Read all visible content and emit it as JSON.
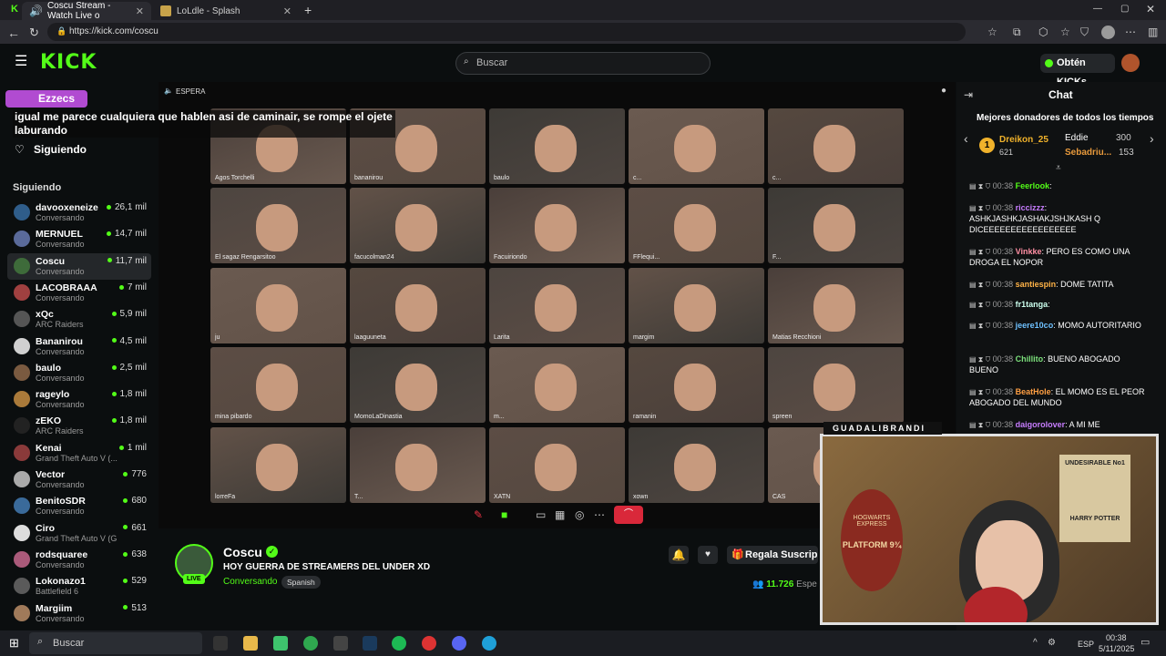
{
  "browser": {
    "tabs": [
      {
        "title": "Coscu Stream - Watch Live o",
        "active": true
      },
      {
        "title": "LoLdle - Splash",
        "active": false
      }
    ],
    "url": "https://kick.com/coscu"
  },
  "header": {
    "search_placeholder": "Buscar",
    "kicks_button": "Obtén KICKs",
    "logo": "KICK"
  },
  "overlay": {
    "user": "Ezzecs",
    "message": "igual me parece cualquiera que hablen asi de caminair, se rompe el ojete laburando"
  },
  "sidebar": {
    "following_label": "Siguiendo",
    "section_label": "Siguiendo",
    "items": [
      {
        "name": "davooxeneize",
        "sub": "Conversando",
        "viewers": "26,1 mil"
      },
      {
        "name": "MERNUEL",
        "sub": "Conversando",
        "viewers": "14,7 mil"
      },
      {
        "name": "Coscu",
        "sub": "Conversando",
        "viewers": "11,7 mil"
      },
      {
        "name": "LACOBRAAA",
        "sub": "Conversando",
        "viewers": "7 mil"
      },
      {
        "name": "xQc",
        "sub": "ARC Raiders",
        "viewers": "5,9 mil"
      },
      {
        "name": "Bananirou",
        "sub": "Conversando",
        "viewers": "4,5 mil"
      },
      {
        "name": "baulo",
        "sub": "Conversando",
        "viewers": "2,5 mil"
      },
      {
        "name": "rageylo",
        "sub": "Conversando",
        "viewers": "1,8 mil"
      },
      {
        "name": "zEKO",
        "sub": "ARC Raiders",
        "viewers": "1,8 mil"
      },
      {
        "name": "Kenai",
        "sub": "Grand Theft Auto V (...",
        "viewers": "1 mil"
      },
      {
        "name": "Vector",
        "sub": "Conversando",
        "viewers": "776"
      },
      {
        "name": "BenitoSDR",
        "sub": "Conversando",
        "viewers": "680"
      },
      {
        "name": "Ciro",
        "sub": "Grand Theft Auto V (G...",
        "viewers": "661"
      },
      {
        "name": "rodsquaree",
        "sub": "Conversando",
        "viewers": "638"
      },
      {
        "name": "Lokonazo1",
        "sub": "Battlefield 6",
        "viewers": "529"
      },
      {
        "name": "Margiim",
        "sub": "Conversando",
        "viewers": "513"
      }
    ]
  },
  "player": {
    "status": "ESPERA",
    "tiles": [
      "Agos Torchelli",
      "bananirou",
      "baulo",
      "c...",
      "c...",
      "El sagaz Rengarsitoo",
      "facucolman24",
      "Facuiriondo",
      "FFlequi...",
      "F...",
      "ju",
      "laaguuneta",
      "Larita",
      "margim",
      "Matias Recchioni",
      "mina pibardo",
      "MomoLaDinastia",
      "m...",
      "ramanin",
      "spreen",
      "lorreFa",
      "T...",
      "XATN",
      "xown",
      "CAS"
    ]
  },
  "stream": {
    "name": "Coscu",
    "title": "HOY GUERRA DE STREAMERS DEL UNDER XD",
    "category": "Conversando",
    "language": "Spanish",
    "live": "LIVE",
    "viewers": "11.726",
    "viewers_suffix": "Espe",
    "gift_label": "Regala Suscrip"
  },
  "chat": {
    "title": "Chat",
    "top_donors": "Mejores donadores de todos los tiempos",
    "donors": [
      {
        "rank": "1",
        "name": "Dreikon_25",
        "amount": "621"
      },
      {
        "name": "Eddie",
        "amount": "300"
      },
      {
        "name": "Sebadriu...",
        "amount": "153"
      }
    ],
    "messages": [
      {
        "time": "00:38",
        "user": "Feerlook",
        "text": ":",
        "color": "#53fc18"
      },
      {
        "time": "00:38",
        "user": "riccizzz",
        "text": ": ASHKJASHKJASHAKJSHJKASH Q DICEEEEEEEEEEEEEEEEE",
        "color": "#c77dff"
      },
      {
        "time": "00:38",
        "user": "Vinkke",
        "text": ": PERO ES COMO UNA DROGA EL NOPOR",
        "color": "#ff8fa3"
      },
      {
        "time": "00:38",
        "user": "santiespin",
        "text": ": DOME TATITA",
        "color": "#ffb347"
      },
      {
        "time": "00:38",
        "user": "fr1tanga",
        "text": ":",
        "color": "#cfe"
      },
      {
        "time": "00:38",
        "user": "jeere10co",
        "text": ": MOMO AUTORITARIO",
        "color": "#6ec1ff"
      },
      {
        "time": "00:38",
        "user": "Chillito",
        "text": ": BUENO ABOGADO BUENO",
        "color": "#7be07b"
      },
      {
        "time": "00:38",
        "user": "BeatHole",
        "text": ": EL MOMO ES EL PEOR ABOGADO DEL MUNDO",
        "color": "#ff9f43"
      },
      {
        "time": "00:38",
        "user": "daigorolover",
        "text": ": A MI ME",
        "color": "#c77dff"
      }
    ]
  },
  "cam": {
    "label": "GUADALIBRANDI",
    "poster1": "UNDESIRABLE No1",
    "poster2": "HARRY POTTER",
    "sign1": "HOGWARTS EXPRESS",
    "sign2": "PLATFORM 9¾"
  },
  "taskbar": {
    "search": "Buscar",
    "time": "00:38",
    "date": "5/11/2025",
    "lang": "ESP"
  }
}
